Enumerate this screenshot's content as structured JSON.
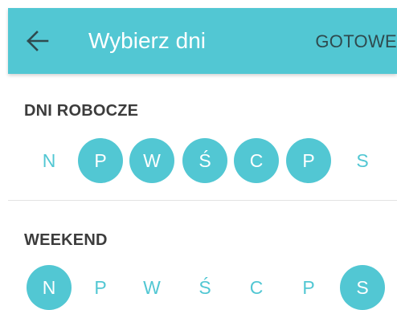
{
  "toolbar": {
    "title": "Wybierz dni",
    "done_label": "GOTOWE",
    "back_icon": "arrow-left-icon"
  },
  "workdays": {
    "header": "DNI ROBOCZE",
    "days": [
      {
        "label": "N",
        "selected": false
      },
      {
        "label": "P",
        "selected": true
      },
      {
        "label": "W",
        "selected": true
      },
      {
        "label": "Ś",
        "selected": true
      },
      {
        "label": "C",
        "selected": true
      },
      {
        "label": "P",
        "selected": true
      },
      {
        "label": "S",
        "selected": false
      }
    ]
  },
  "weekend": {
    "header": "WEEKEND",
    "days": [
      {
        "label": "N",
        "selected": true
      },
      {
        "label": "P",
        "selected": false
      },
      {
        "label": "W",
        "selected": false
      },
      {
        "label": "Ś",
        "selected": false
      },
      {
        "label": "C",
        "selected": false
      },
      {
        "label": "P",
        "selected": false
      },
      {
        "label": "S",
        "selected": true
      }
    ]
  },
  "colors": {
    "accent": "#52c7d3",
    "toolbar_text": "#ffffff",
    "done_text": "#2f4a4e",
    "header_text": "#3c3c3c"
  }
}
